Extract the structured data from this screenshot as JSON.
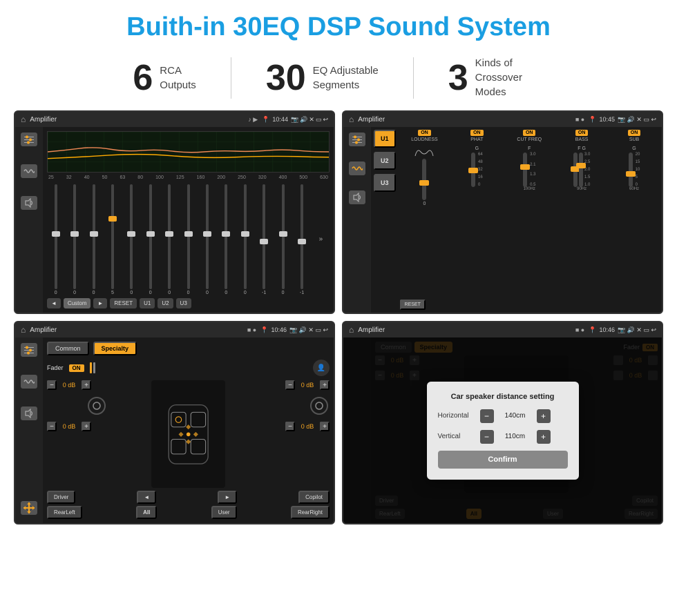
{
  "header": {
    "title": "Buith-in 30EQ DSP Sound System"
  },
  "stats": [
    {
      "number": "6",
      "label_line1": "RCA",
      "label_line2": "Outputs"
    },
    {
      "number": "30",
      "label_line1": "EQ Adjustable",
      "label_line2": "Segments"
    },
    {
      "number": "3",
      "label_line1": "Kinds of",
      "label_line2": "Crossover Modes"
    }
  ],
  "screens": [
    {
      "id": "eq-screen",
      "status": {
        "title": "Amplifier",
        "time": "10:44"
      },
      "freq_labels": [
        "25",
        "32",
        "40",
        "50",
        "63",
        "80",
        "100",
        "125",
        "160",
        "200",
        "250",
        "320",
        "400",
        "500",
        "630"
      ],
      "slider_values": [
        "0",
        "0",
        "0",
        "5",
        "0",
        "0",
        "0",
        "0",
        "0",
        "0",
        "0",
        "-1",
        "0",
        "-1"
      ],
      "bottom_buttons": [
        "Custom",
        "RESET",
        "U1",
        "U2",
        "U3"
      ]
    },
    {
      "id": "crossover-screen",
      "status": {
        "title": "Amplifier",
        "time": "10:45"
      },
      "u_buttons": [
        "U1",
        "U2",
        "U3"
      ],
      "controls": [
        "LOUDNESS",
        "PHAT",
        "CUT FREQ",
        "BASS",
        "SUB"
      ],
      "reset_label": "RESET"
    },
    {
      "id": "fader-screen",
      "status": {
        "title": "Amplifier",
        "time": "10:46"
      },
      "tabs": [
        "Common",
        "Specialty"
      ],
      "fader_label": "Fader",
      "on_label": "ON",
      "db_labels": [
        "0 dB",
        "0 dB",
        "0 dB",
        "0 dB"
      ],
      "bottom_buttons": [
        "Driver",
        "",
        "Copilot",
        "RearLeft",
        "All",
        "User",
        "RearRight"
      ]
    },
    {
      "id": "dialog-screen",
      "status": {
        "title": "Amplifier",
        "time": "10:46"
      },
      "tabs": [
        "Common",
        "Specialty"
      ],
      "on_label": "ON",
      "dialog": {
        "title": "Car speaker distance setting",
        "horizontal_label": "Horizontal",
        "horizontal_value": "140cm",
        "vertical_label": "Vertical",
        "vertical_value": "110cm",
        "confirm_label": "Confirm"
      },
      "bottom_buttons": [
        "Driver",
        "Copilot",
        "RearLeft",
        "All",
        "User",
        "RearRight"
      ]
    }
  ]
}
